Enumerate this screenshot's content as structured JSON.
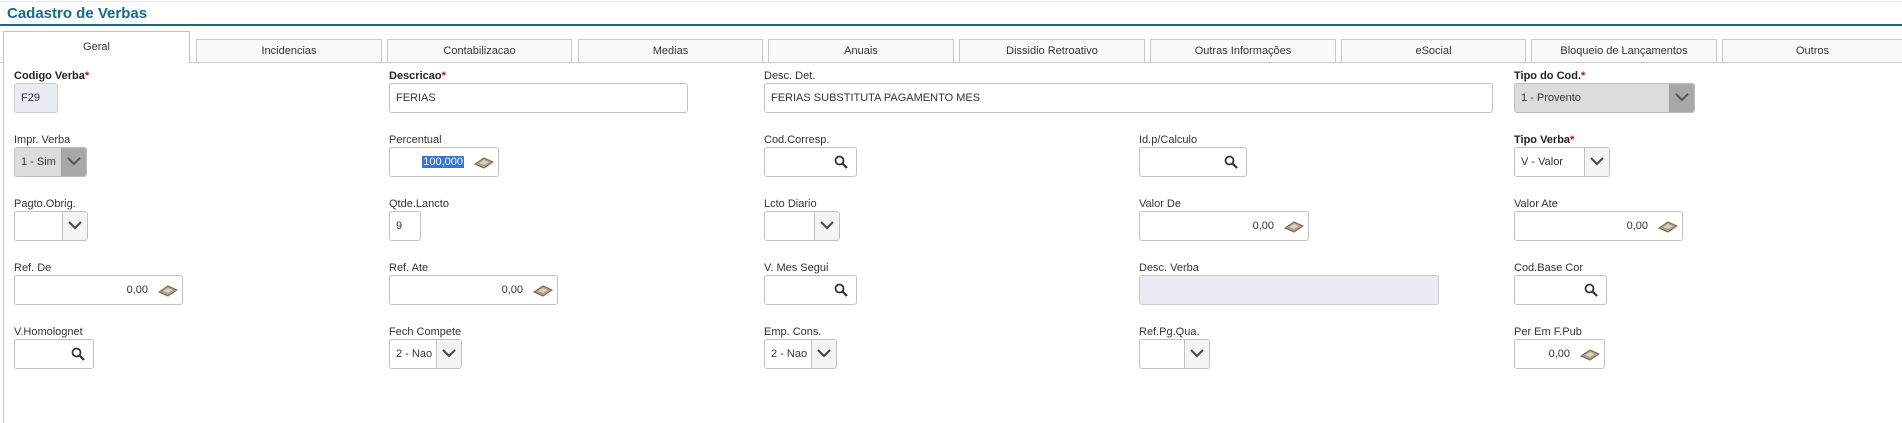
{
  "page": {
    "title": "Cadastro de Verbas"
  },
  "tabs": [
    {
      "label": "Geral"
    },
    {
      "label": "Incidencias"
    },
    {
      "label": "Contabilizacao"
    },
    {
      "label": "Medias"
    },
    {
      "label": "Anuais"
    },
    {
      "label": "Dissidio Retroativo"
    },
    {
      "label": "Outras Informações"
    },
    {
      "label": "eSocial"
    },
    {
      "label": "Bloqueio de Lançamentos"
    },
    {
      "label": "Outros"
    }
  ],
  "fields": {
    "codigo_verba": {
      "label": "Codigo Verba",
      "required": "*",
      "value": "F29"
    },
    "descricao": {
      "label": "Descricao",
      "required": "*",
      "value": "FERIAS"
    },
    "desc_det": {
      "label": "Desc. Det.",
      "value": "FERIAS SUBSTITUTA PAGAMENTO MES"
    },
    "tipo_cod": {
      "label": "Tipo do Cod.",
      "required": "*",
      "value": "1 - Provento"
    },
    "impr_verba": {
      "label": "Impr. Verba",
      "value": "1 - Sim"
    },
    "percentual": {
      "label": "Percentual",
      "value": "100,000"
    },
    "cod_corresp": {
      "label": "Cod.Corresp.",
      "value": ""
    },
    "id_calculo": {
      "label": "Id.p/Calculo",
      "value": ""
    },
    "tipo_verba": {
      "label": "Tipo Verba",
      "required": "*",
      "value": "V - Valor"
    },
    "pagto_obrig": {
      "label": "Pagto.Obrig.",
      "value": ""
    },
    "qtde_lancto": {
      "label": "Qtde.Lancto",
      "value": "9"
    },
    "lcto_diario": {
      "label": "Lcto Diario",
      "value": ""
    },
    "valor_de": {
      "label": "Valor De",
      "value": "0,00"
    },
    "valor_ate": {
      "label": "Valor Ate",
      "value": "0,00"
    },
    "ref_de": {
      "label": "Ref. De",
      "value": "0,00"
    },
    "ref_ate": {
      "label": "Ref. Ate",
      "value": "0,00"
    },
    "v_mes_segui": {
      "label": "V. Mes Segui",
      "value": ""
    },
    "desc_verba": {
      "label": "Desc. Verba",
      "value": ""
    },
    "cod_base_cor": {
      "label": "Cod.Base Cor",
      "value": ""
    },
    "v_homolognet": {
      "label": "V.Homolognet",
      "value": ""
    },
    "fech_compete": {
      "label": "Fech Compete",
      "value": "2 - Nao"
    },
    "emp_cons": {
      "label": "Emp. Cons.",
      "value": "2 - Nao"
    },
    "ref_pg_qua": {
      "label": "Ref.Pg.Qua.",
      "value": ""
    },
    "per_em_f_pub": {
      "label": "Per Em F.Pub",
      "value": "0,00"
    }
  },
  "icons": {
    "lookup": "search-icon",
    "calculator": "calculator-icon",
    "dropdown": "chevron-down-icon"
  },
  "colors": {
    "title": "#176b87",
    "required": "#d0021b",
    "selection": "#3875d7"
  }
}
